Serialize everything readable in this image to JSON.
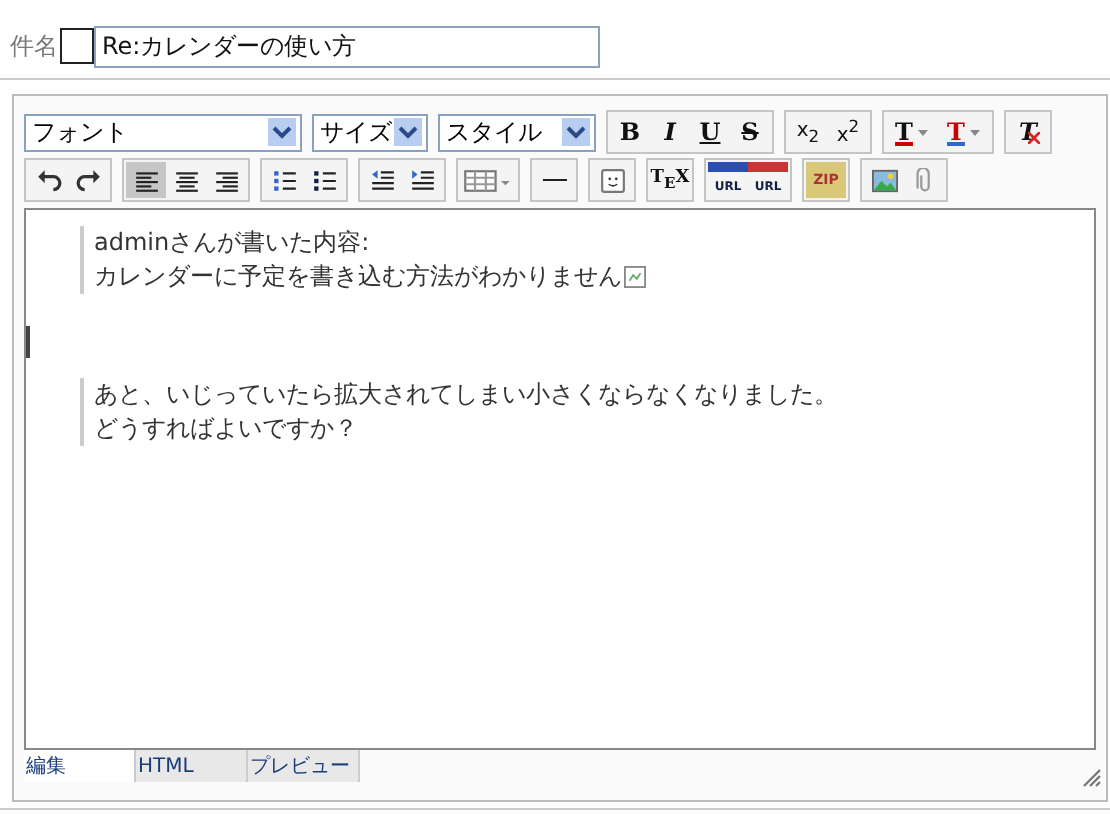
{
  "subject": {
    "label": "件名",
    "value": "Re:カレンダーの使い方"
  },
  "selects": [
    {
      "label": "フォント"
    },
    {
      "label": "サイズ"
    },
    {
      "label": "スタイル"
    }
  ],
  "row1": [
    [
      {
        "kind": "bold",
        "label": "B"
      },
      {
        "kind": "italic",
        "label": "I"
      },
      {
        "kind": "underline",
        "label": "U"
      },
      {
        "kind": "strike",
        "label": "S"
      }
    ],
    [
      {
        "kind": "script",
        "label": "x$_{2}$"
      },
      {
        "kind": "script",
        "label": "x$^{2}$"
      }
    ],
    [
      {
        "kind": "forecolor",
        "label": "T"
      },
      {
        "kind": "backcolor",
        "label": "T"
      }
    ],
    [
      {
        "kind": "removeformat",
        "label": "T"
      }
    ]
  ],
  "row2": [
    [
      {
        "kind": "undo"
      },
      {
        "kind": "redo"
      }
    ],
    [
      {
        "kind": "align-left",
        "selected": true
      },
      {
        "kind": "align-center",
        "selected": false
      },
      {
        "kind": "align-right",
        "selected": false
      }
    ],
    [
      {
        "kind": "ol"
      },
      {
        "kind": "ul"
      }
    ],
    [
      {
        "kind": "outdent"
      },
      {
        "kind": "indent"
      }
    ],
    [
      {
        "kind": "table"
      }
    ],
    [
      {
        "kind": "hr"
      }
    ],
    [
      {
        "kind": "smiley"
      }
    ],
    [
      {
        "kind": "tex",
        "label": "T$_{E}$X"
      }
    ],
    [
      {
        "kind": "link",
        "label": "URL"
      },
      {
        "kind": "unlink",
        "label": "URL"
      }
    ],
    [
      {
        "kind": "zip",
        "label": "ZIP"
      }
    ],
    [
      {
        "kind": "image"
      },
      {
        "kind": "attach"
      }
    ]
  ],
  "content": [
    {
      "kind": "quote",
      "lines": [
        {
          "text": "adminさんが書いた内容:",
          "image": false
        },
        {
          "text": "カレンダーに予定を書き込む方法がわかりません",
          "image": true
        }
      ]
    },
    {
      "kind": "cursor"
    },
    {
      "kind": "quote",
      "lines": [
        {
          "text": "あと、いじっていたら拡大されてしまい小さくならなくなりました。",
          "image": false
        },
        {
          "text": "どうすればよいですか？",
          "image": false
        }
      ]
    }
  ],
  "tabs": [
    {
      "label": "編集",
      "selected": true
    },
    {
      "label": "HTML",
      "selected": false
    },
    {
      "label": "プレビュー",
      "selected": false
    }
  ]
}
